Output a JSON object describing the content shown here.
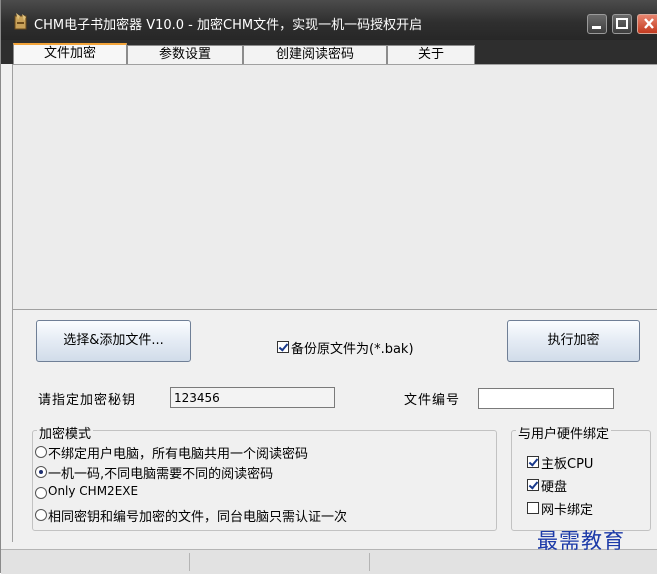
{
  "window": {
    "title": "CHM电子书加密器 V10.0 - 加密CHM文件，实现一机一码授权开启",
    "icon": "chm-app-icon"
  },
  "tabs": [
    {
      "label": "文件加密",
      "active": true
    },
    {
      "label": "参数设置",
      "active": false
    },
    {
      "label": "创建阅读密码",
      "active": false
    },
    {
      "label": "关于",
      "active": false
    }
  ],
  "actions": {
    "select_files_label": "选择&添加文件...",
    "backup_label": "备份原文件为(*.bak)",
    "backup_checked": true,
    "encrypt_label": "执行加密"
  },
  "key": {
    "label": "请指定加密秘钥",
    "value": "123456"
  },
  "file_number": {
    "label": "文件编号",
    "value": ""
  },
  "mode": {
    "title": "加密模式",
    "options": [
      {
        "label": "不绑定用户电脑，所有电脑共用一个阅读密码",
        "selected": false
      },
      {
        "label": "一机一码,不同电脑需要不同的阅读密码",
        "selected": true
      },
      {
        "label": "Only CHM2EXE",
        "selected": false
      },
      {
        "label": "相同密钥和编号加密的文件，同台电脑只需认证一次",
        "selected": false
      }
    ]
  },
  "hardware": {
    "title": "与用户硬件绑定",
    "options": [
      {
        "label": "主板CPU",
        "checked": true
      },
      {
        "label": "硬盘",
        "checked": true
      },
      {
        "label": "网卡绑定",
        "checked": false
      }
    ]
  },
  "watermark": "最需教育",
  "colors": {
    "titlebar": "#2f2f2f",
    "tab_accent": "#f4a53a",
    "watermark": "#1c3aa8",
    "close_button": "#c23a1f"
  }
}
